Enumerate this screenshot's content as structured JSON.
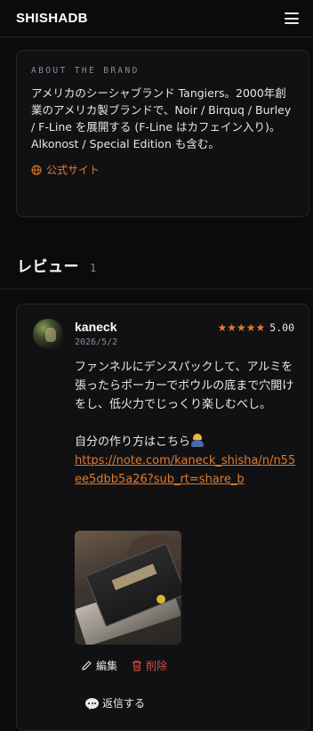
{
  "header": {
    "brand": "SHISHADB",
    "menu_icon": "hamburger-menu-icon"
  },
  "about": {
    "label": "ABOUT THE BRAND",
    "text": "アメリカのシーシャブランド Tangiers。2000年創業のアメリカ製ブランドで、Noir / Birquq / Burley / F-Line を展開する (F-Line はカフェイン入り)。Alkonost / Special Edition も含む。",
    "link_label": "公式サイト",
    "link_icon": "globe-icon"
  },
  "reviews": {
    "title": "レビュー",
    "count": "1",
    "items": [
      {
        "reviewer": "kaneck",
        "date": "2026/5/2",
        "rating": 5,
        "rating_text": "5.00",
        "body_paragraph": "ファンネルにデンスパックして、アルミを張ったらポーカーでボウルの底まで穴開けをし、低火力でじっくり楽しむべし。",
        "body_intro": "自分の作り方はこちら",
        "body_emoji": "construction-worker-emoji",
        "link_text": "https://note.com/kaneck_shisha/n/n55ee5dbb5a26?sub_rt=share_b",
        "edit_label": "編集",
        "delete_label": "削除",
        "reply_label": "返信する"
      }
    ]
  },
  "colors": {
    "accent": "#e07a2c",
    "star": "#e8782c",
    "delete": "#d94a3d",
    "background": "#0b0b0d",
    "card": "#111114"
  }
}
